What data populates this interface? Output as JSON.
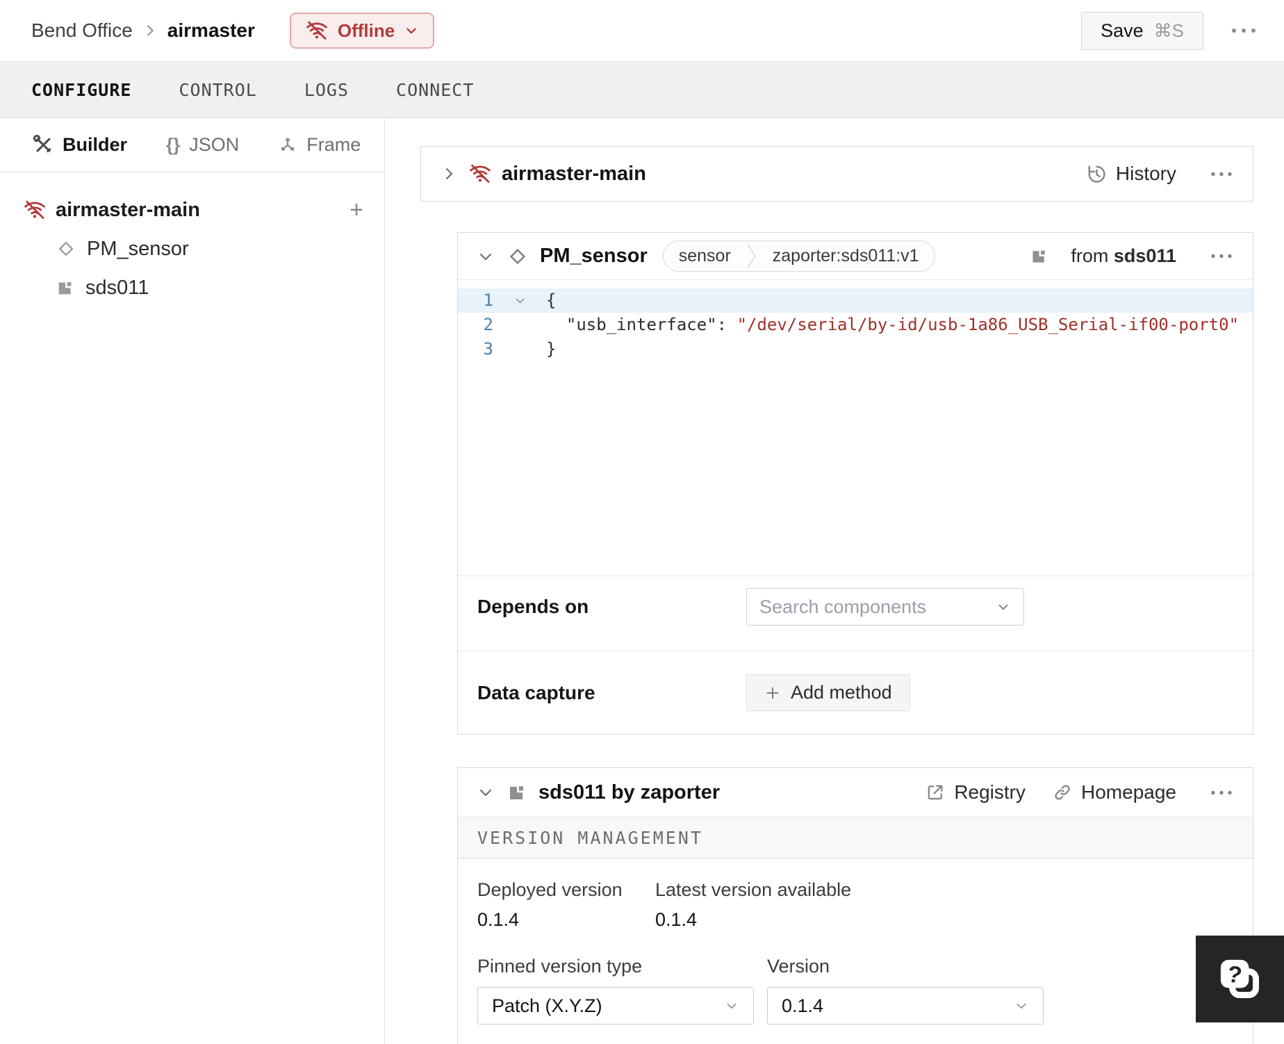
{
  "colors": {
    "status_offline": "#b23b3b",
    "code_string": "#a03128",
    "code_line_number": "#4b7fa3"
  },
  "topbar": {
    "breadcrumb_org": "Bend Office",
    "breadcrumb_machine": "airmaster",
    "status_label": "Offline",
    "save_label": "Save",
    "save_shortcut": "⌘S"
  },
  "tabs": {
    "t0": "CONFIGURE",
    "t1": "CONTROL",
    "t2": "LOGS",
    "t3": "CONNECT"
  },
  "sidebar": {
    "view_builder": "Builder",
    "view_json": "JSON",
    "view_frame": "Frame",
    "json_glyph": "{}",
    "root": "airmaster-main",
    "child_component": "PM_sensor",
    "child_module": "sds011",
    "add_glyph": "+"
  },
  "machine_card": {
    "title": "airmaster-main",
    "history_label": "History"
  },
  "component_card": {
    "title": "PM_sensor",
    "tag_type": "sensor",
    "tag_model": "zaporter:sds011:v1",
    "from_prefix": "from",
    "from_module": "sds011",
    "code_line1_num": "1",
    "code_line1_text": "{",
    "code_line2_num": "2",
    "code_line2_indent": "  ",
    "code_line2_key": "\"usb_interface\"",
    "code_line2_colon": ": ",
    "code_line2_value": "\"/dev/serial/by-id/usb-1a86_USB_Serial-if00-port0\"",
    "code_line3_num": "3",
    "code_line3_text": "}",
    "depends_label": "Depends on",
    "depends_placeholder": "Search components",
    "capture_label": "Data capture",
    "capture_button": "Add method"
  },
  "module_card": {
    "title": "sds011 by zaporter",
    "registry_label": "Registry",
    "homepage_label": "Homepage",
    "section_title": "VERSION MANAGEMENT",
    "deployed_label": "Deployed version",
    "deployed_value": "0.1.4",
    "latest_label": "Latest version available",
    "latest_value": "0.1.4",
    "pinned_label": "Pinned version type",
    "pinned_value": "Patch (X.Y.Z)",
    "version_label": "Version",
    "version_value": "0.1.4"
  },
  "help_glyph": "?"
}
